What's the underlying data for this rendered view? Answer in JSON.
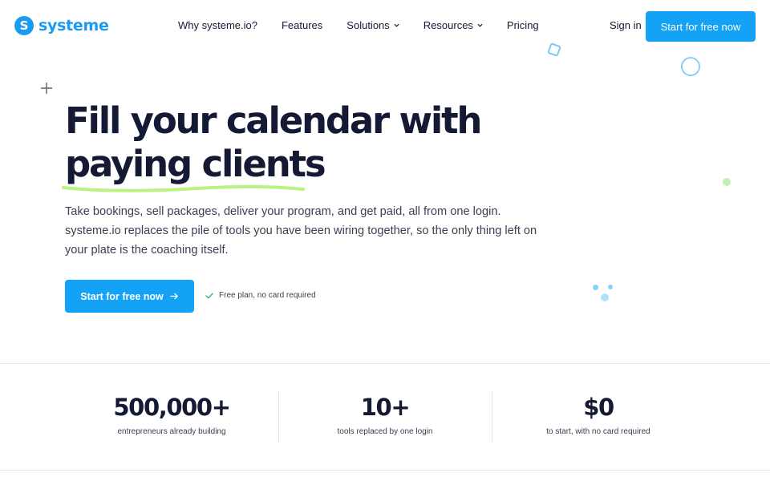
{
  "header": {
    "logo_mark": "S",
    "logo_text": "systeme",
    "nav": [
      {
        "label": "Why systeme.io?",
        "has_dropdown": false
      },
      {
        "label": "Features",
        "has_dropdown": false
      },
      {
        "label": "Solutions",
        "has_dropdown": true
      },
      {
        "label": "Resources",
        "has_dropdown": true
      },
      {
        "label": "Pricing",
        "has_dropdown": false
      }
    ],
    "sign_in": "Sign in",
    "cta": "Start for free now"
  },
  "hero": {
    "title_line1": "Fill your calendar with",
    "title_line2": "paying clients",
    "body": "Take bookings, sell packages, deliver your program, and get paid, all from one login. systeme.io replaces the pile of tools you have been wiring together, so the only thing left on your plate is the coaching itself.",
    "cta": "Start for free now",
    "note": "Free plan, no card required"
  },
  "stats": [
    {
      "value": "500,000+",
      "label": "entrepreneurs already building"
    },
    {
      "value": "10+",
      "label": "tools replaced by one login"
    },
    {
      "value": "$0",
      "label": "to start, with no card required"
    }
  ],
  "colors": {
    "brand_blue": "#13a2f5",
    "logo_blue": "#1a9bf0",
    "heading": "#141a33",
    "underline_green": "#b9f27c"
  },
  "icons": [
    "logo-icon",
    "chevron-down-icon",
    "arrow-right-icon",
    "check-icon",
    "plus-icon"
  ]
}
